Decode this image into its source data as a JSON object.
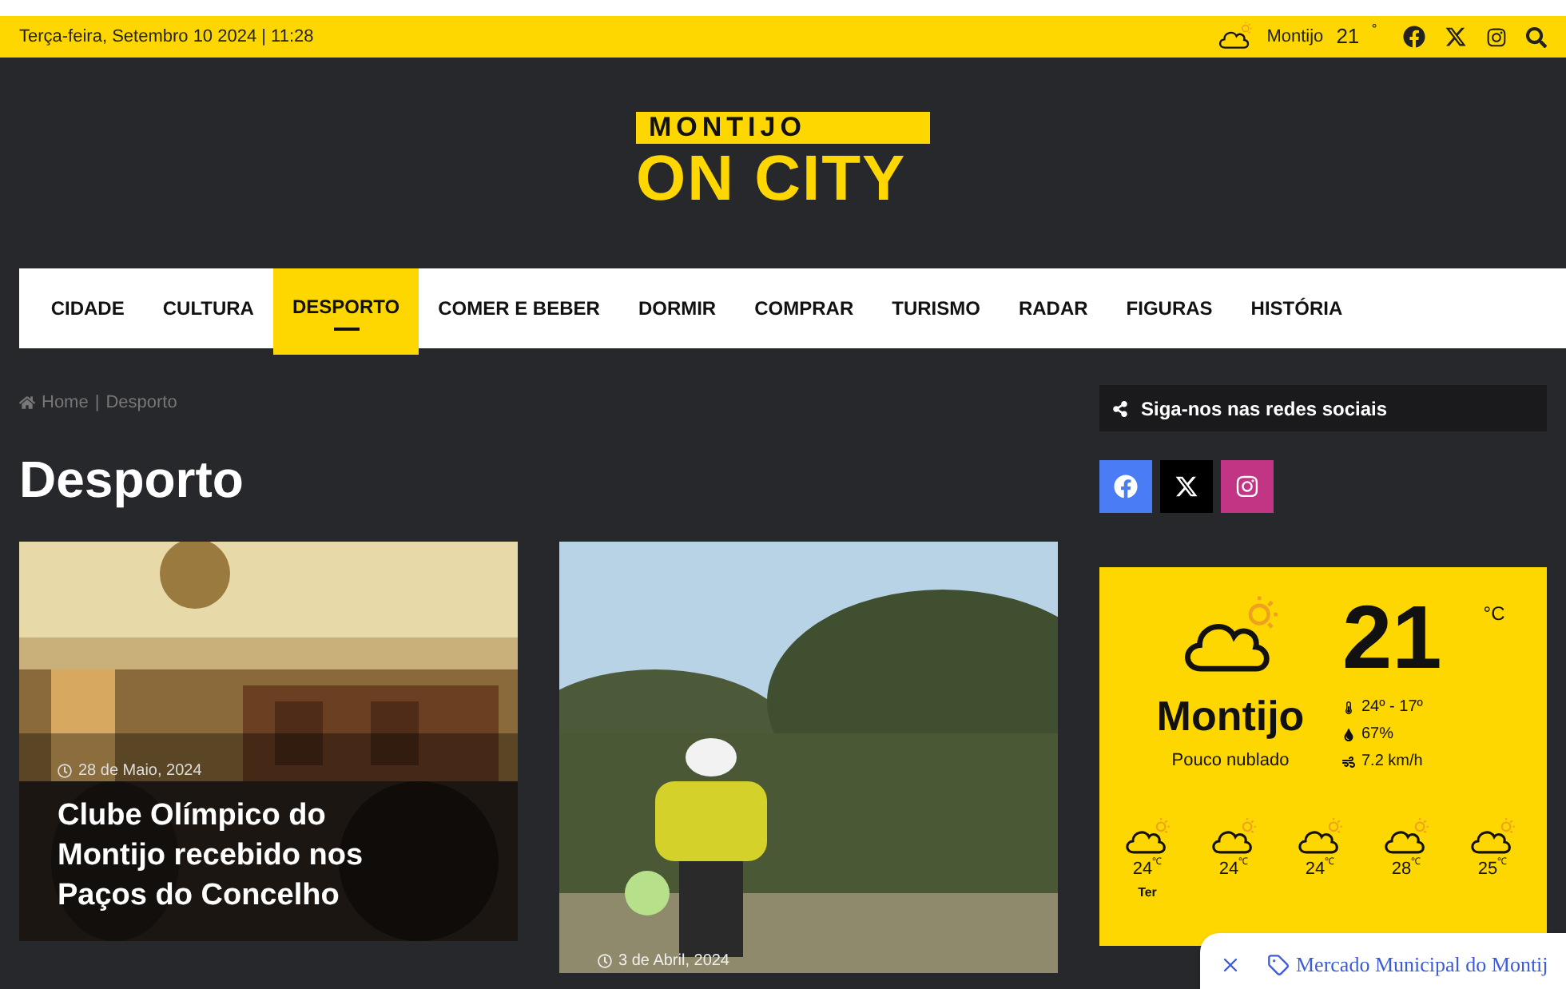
{
  "top_bar": {
    "date": "Terça-feira, Setembro 10 2024 | 11:28",
    "weather_city": "Montijo",
    "weather_temp": "21",
    "weather_unit": "˚"
  },
  "logo": {
    "line_1": "MONTIJO",
    "line_2": "ON CITY"
  },
  "nav": [
    {
      "label": "CIDADE",
      "selected": false
    },
    {
      "label": "CULTURA",
      "selected": false
    },
    {
      "label": "DESPORTO",
      "selected": true
    },
    {
      "label": "COMER E BEBER",
      "selected": false
    },
    {
      "label": "DORMIR",
      "selected": false
    },
    {
      "label": "COMPRAR",
      "selected": false
    },
    {
      "label": "TURISMO",
      "selected": false
    },
    {
      "label": "RADAR",
      "selected": false
    },
    {
      "label": "FIGURAS",
      "selected": false
    },
    {
      "label": "HISTÓRIA",
      "selected": false
    }
  ],
  "breadcrumb": {
    "home": "Home",
    "separator": "|",
    "current": "Desporto"
  },
  "page_title": "Desporto",
  "articles": [
    {
      "date": "28 de Maio, 2024",
      "title": "Clube Olímpico do Montijo recebido nos Paços do Concelho",
      "kind": "overlay"
    },
    {
      "date": "3 de Abril, 2024"
    }
  ],
  "social": {
    "heading": "Siga-nos nas redes sociais",
    "buttons": [
      {
        "kind": "facebook",
        "color": "#4a7cf6"
      },
      {
        "kind": "x",
        "color": "#000000"
      },
      {
        "kind": "instagram",
        "color": "#c13584"
      }
    ]
  },
  "weather": {
    "temp": "21",
    "unit": "°C",
    "city": "Montijo",
    "description": "Pouco nublado",
    "range": "24º - 17º",
    "humidity": "67%",
    "wind": "7.2 km/h",
    "forecast": [
      {
        "temp": "24",
        "unit": "℃",
        "day": "Ter"
      },
      {
        "temp": "24",
        "unit": "℃"
      },
      {
        "temp": "24",
        "unit": "℃"
      },
      {
        "temp": "28",
        "unit": "℃"
      },
      {
        "temp": "25",
        "unit": "℃"
      }
    ]
  },
  "popup": {
    "text": "Mercado Municipal do Montij"
  }
}
